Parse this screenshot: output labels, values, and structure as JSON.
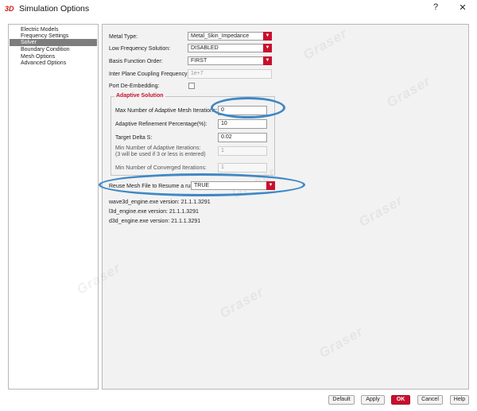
{
  "window": {
    "app_logo": "3D",
    "title": "Simulation Options",
    "help_label": "?",
    "close_label": "✕"
  },
  "tree": {
    "items": [
      "Electric Models",
      "Frequency Settings",
      "Solver",
      "Boundary Condition",
      "Mesh Options",
      "Advanced Options"
    ],
    "selected": "Solver"
  },
  "form": {
    "metal_type": {
      "label": "Metal Type:",
      "value": "Metal_Skin_Impedance"
    },
    "low_frequency": {
      "label": "Low Frequency Solution:",
      "value": "DISABLED"
    },
    "basis_order": {
      "label": "Basis Function Order:",
      "value": "FIRST"
    },
    "inter_plane": {
      "label": "Inter Plane Coupling Frequency:",
      "value": "1e+7"
    },
    "port_deembedding": {
      "label": "Port De-Embedding:",
      "checked": false
    },
    "adaptive": {
      "title": "Adaptive Solution",
      "max_iterations": {
        "label": "Max Number of Adaptive Mesh Iterations:",
        "value": "0"
      },
      "refinement": {
        "label": "Adaptive Refinement Percentage(%):",
        "value": "10"
      },
      "target_delta": {
        "label": "Target Delta S:",
        "value": "0.02"
      },
      "min_iterations": {
        "label_line1": "Min Number of Adaptive Iterations:",
        "label_line2": "(3 will be used if 3 or less is entered)",
        "value": "1"
      },
      "min_converged": {
        "label": "Min Number of Converged Iterations:",
        "value": "1"
      }
    },
    "reuse_mesh": {
      "label": "Reuse Mesh File to Resume a run:",
      "value": "TRUE"
    },
    "versions": [
      "wave3d_engine.exe version: 21.1.1.3291",
      "l3d_engine.exe version: 21.1.1.3291",
      "d3d_engine.exe version: 21.1.1.3291"
    ]
  },
  "watermark": "Graser",
  "buttons": {
    "default": "Default",
    "apply": "Apply",
    "ok": "OK",
    "cancel": "Cancel",
    "help": "Help"
  },
  "colors": {
    "accent": "#c8102e",
    "highlight_ellipse": "#3f88c5",
    "tree_selected": "#7d7d7d"
  }
}
